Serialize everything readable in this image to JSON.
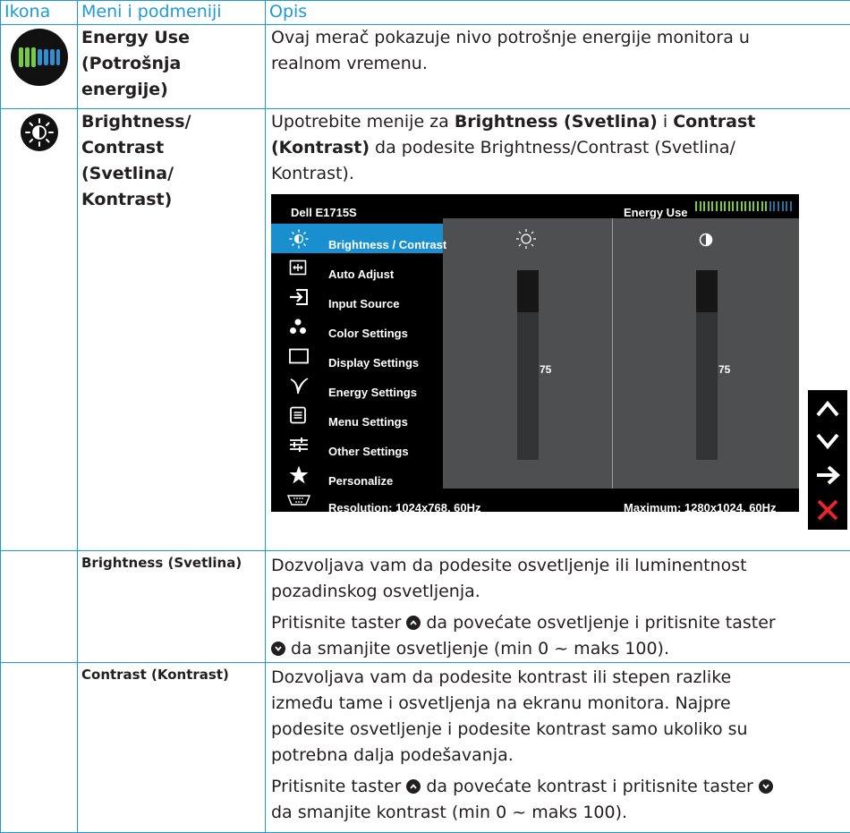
{
  "header": {
    "col_icon": "Ikona",
    "col_menu": "Meni i podmeniji",
    "col_desc": "Opis"
  },
  "rows": {
    "energy": {
      "icon": "energy-use-meter-icon",
      "menu_1": "Energy Use",
      "menu_2": "(Potrošnja",
      "menu_3": "energije)",
      "desc_1": "Ovaj merač pokazuje nivo potrošnje energije monitora u",
      "desc_2": "realnom vremenu."
    },
    "brightness_contrast": {
      "icon": "brightness-contrast-icon",
      "menu_1": "Brightness/",
      "menu_2": "Contrast",
      "menu_3": "(Svetlina/",
      "menu_4": "Kontrast)",
      "desc_a": "Upotrebite menije za ",
      "desc_b": "Brightness (Svetlina)",
      "desc_c": " i ",
      "desc_d": "Contrast",
      "desc_e": "(Kontrast)",
      "desc_f": " da podesite Brightness/Contrast (Svetlina/",
      "desc_g": "Kontrast)."
    },
    "brightness": {
      "menu": "Brightness (Svetlina)",
      "desc_1": "Dozvoljava vam da podesite osvetljenje ili luminentnost",
      "desc_2": "pozadinskog osvetljenja.",
      "desc_3a": "Pritisnite taster ",
      "desc_3b": " da povećate osvetljenje i pritisnite taster",
      "desc_4b": " da smanjite osvetljenje (min 0 ~ maks 100)."
    },
    "contrast": {
      "menu": "Contrast (Kontrast)",
      "desc_1": "Dozvoljava vam da podesite kontrast ili stepen razlike",
      "desc_2": "između tame i osvetljenja na ekranu monitora. Najpre",
      "desc_3": "podesite osvetljenje i podesite kontrast samo ukoliko su",
      "desc_4": "potrebna dalja podešavanja.",
      "desc_5a": "Pritisnite taster ",
      "desc_5b": " da povećate kontrast i pritisnite taster ",
      "desc_6": "da smanjite kontrast (min 0 ~ maks 100)."
    }
  },
  "osd": {
    "model": "Dell E1715S",
    "energy_label": "Energy Use",
    "energy_level": 0.75,
    "menu_items": [
      {
        "label": "Brightness / Contrast",
        "icon": "sun-icon",
        "selected": true
      },
      {
        "label": "Auto Adjust",
        "icon": "auto-adjust-icon",
        "selected": false
      },
      {
        "label": "Input Source",
        "icon": "input-source-icon",
        "selected": false
      },
      {
        "label": "Color Settings",
        "icon": "color-settings-icon",
        "selected": false
      },
      {
        "label": "Display Settings",
        "icon": "display-settings-icon",
        "selected": false
      },
      {
        "label": "Energy Settings",
        "icon": "energy-settings-icon",
        "selected": false
      },
      {
        "label": "Menu Settings",
        "icon": "menu-settings-icon",
        "selected": false
      },
      {
        "label": "Other Settings",
        "icon": "other-settings-icon",
        "selected": false
      },
      {
        "label": "Personalize",
        "icon": "star-icon",
        "selected": false
      }
    ],
    "brightness_value": "75",
    "contrast_value": "75",
    "brightness_level": 75,
    "contrast_level": 75,
    "resolution": "Resolution: 1024x768, 60Hz",
    "maximum": "Maximum: 1280x1024, 60Hz"
  },
  "nav_buttons": [
    "up-arrow-icon",
    "down-arrow-icon",
    "right-arrow-icon",
    "close-icon"
  ],
  "colors": {
    "accent": "#1d9ad6",
    "osd_selected": "#1a8fd0",
    "energy_green": "#7ac943",
    "close_red": "#e8262a"
  }
}
